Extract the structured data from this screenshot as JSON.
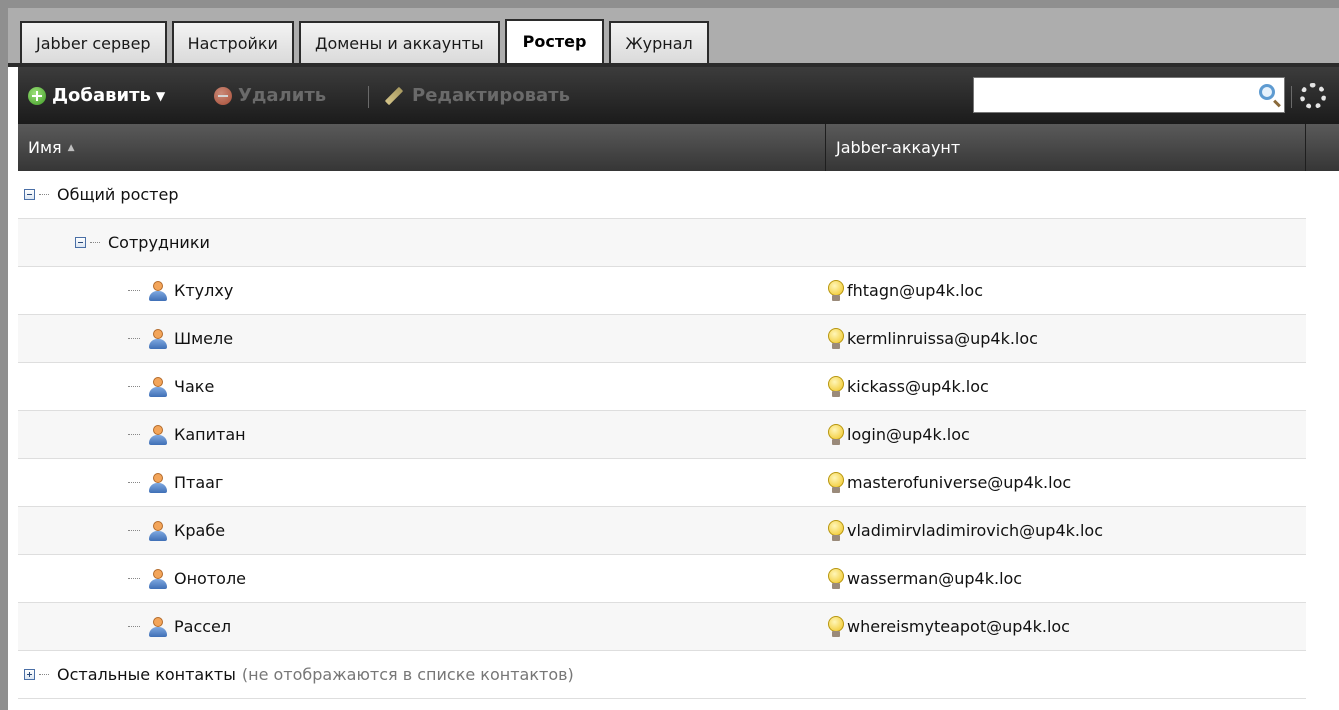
{
  "tabs": [
    {
      "label": "Jabber сервер",
      "active": false
    },
    {
      "label": "Настройки",
      "active": false
    },
    {
      "label": "Домены и аккаунты",
      "active": false
    },
    {
      "label": "Ростер",
      "active": true
    },
    {
      "label": "Журнал",
      "active": false
    }
  ],
  "toolbar": {
    "add_label": "Добавить",
    "delete_label": "Удалить",
    "edit_label": "Редактировать",
    "search_value": "",
    "search_placeholder": ""
  },
  "columns": {
    "name": "Имя",
    "jid": "Jabber-аккаунт",
    "sort": "ascending"
  },
  "tree": {
    "shared_group": "Общий ростер",
    "subgroup": "Сотрудники",
    "contacts": [
      {
        "name": "Ктулху",
        "jid": "fhtagn@up4k.loc"
      },
      {
        "name": "Шмеле",
        "jid": "kermlinruissa@up4k.loc"
      },
      {
        "name": "Чаке",
        "jid": "kickass@up4k.loc"
      },
      {
        "name": "Капитан",
        "jid": "login@up4k.loc"
      },
      {
        "name": "Птааг",
        "jid": "masterofuniverse@up4k.loc"
      },
      {
        "name": "Крабе",
        "jid": "vladimirvladimirovich@up4k.loc"
      },
      {
        "name": "Онотоле",
        "jid": "wasserman@up4k.loc"
      },
      {
        "name": "Рассел",
        "jid": "whereismyteapot@up4k.loc"
      }
    ],
    "other_group": "Остальные контакты",
    "other_note": "(не отображаются в списке контактов)"
  }
}
